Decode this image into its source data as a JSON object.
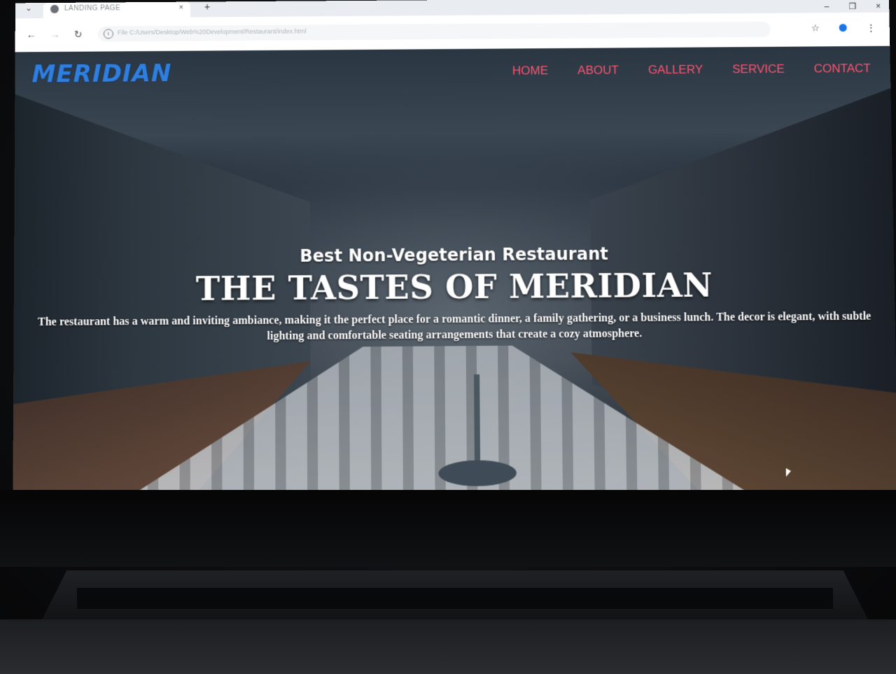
{
  "browser": {
    "tab_title": "LANDING PAGE",
    "tab_close": "×",
    "new_tab": "+",
    "url": "File   C:/Users/Desktop/Web%20Development/Restaurant/index.html",
    "window_minimize": "–",
    "window_restore": "❐",
    "window_close": "×"
  },
  "site": {
    "logo": "MERIDIAN",
    "nav": [
      {
        "label": "HOME"
      },
      {
        "label": "ABOUT"
      },
      {
        "label": "GALLERY"
      },
      {
        "label": "SERVICE"
      },
      {
        "label": "CONTACT"
      }
    ],
    "hero": {
      "subtitle": "Best Non-Vegeterian Restaurant",
      "title": "THE TASTES OF MERIDIAN",
      "description": "The restaurant has a warm and inviting ambiance, making it the perfect place for a romantic dinner, a family gathering, or a business lunch. The decor is elegant, with subtle lighting and comfortable seating arrangements that create a cozy atmosphere."
    }
  },
  "colors": {
    "logo": "#2f7fe0",
    "nav": "#ff5470"
  }
}
